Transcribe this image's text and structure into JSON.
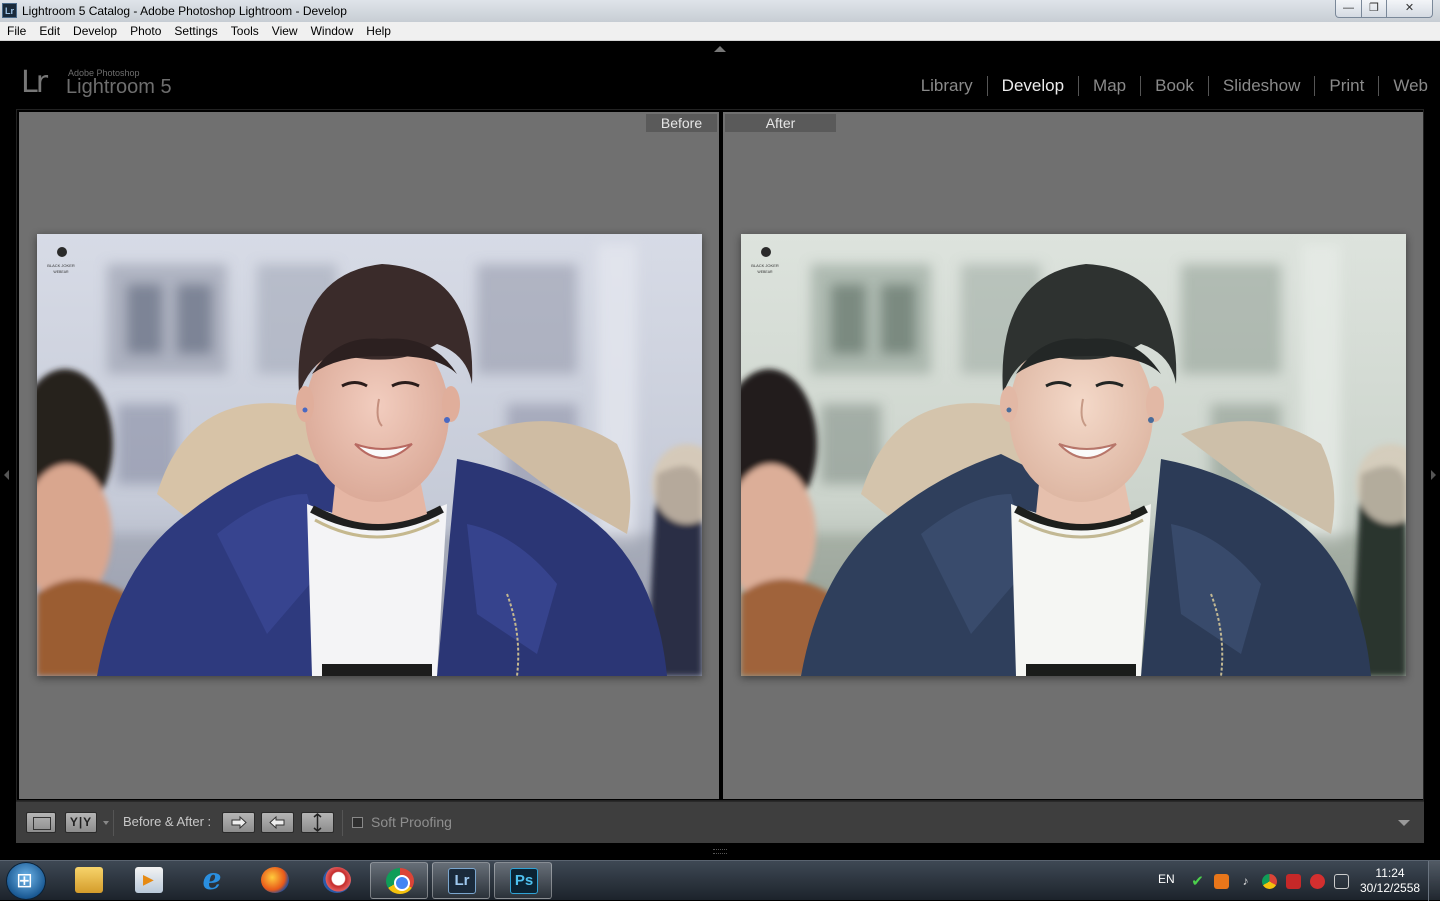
{
  "window": {
    "title": "Lightroom 5 Catalog - Adobe Photoshop Lightroom - Develop",
    "app_badge": "Lr",
    "controls": {
      "minimize": "—",
      "maximize": "❐",
      "close": "✕"
    }
  },
  "menu": [
    "File",
    "Edit",
    "Develop",
    "Photo",
    "Settings",
    "Tools",
    "View",
    "Window",
    "Help"
  ],
  "branding": {
    "logo": "Lr",
    "vendor": "Adobe Photoshop",
    "product": "Lightroom 5"
  },
  "modules": [
    {
      "label": "Library",
      "active": false
    },
    {
      "label": "Develop",
      "active": true
    },
    {
      "label": "Map",
      "active": false
    },
    {
      "label": "Book",
      "active": false
    },
    {
      "label": "Slideshow",
      "active": false
    },
    {
      "label": "Print",
      "active": false
    },
    {
      "label": "Web",
      "active": false
    }
  ],
  "view": {
    "before_label": "Before",
    "after_label": "After",
    "watermark_line1": "BLACK JOKER",
    "watermark_line2": "WEBEAR"
  },
  "toolbar": {
    "view_mode_label": "Y|Y",
    "before_after_label": "Before & After :",
    "soft_proofing_label": "Soft Proofing",
    "soft_proofing_checked": false
  },
  "taskbar": {
    "apps": [
      {
        "name": "windows-explorer",
        "open": false
      },
      {
        "name": "media-player",
        "open": false
      },
      {
        "name": "internet-explorer",
        "open": false
      },
      {
        "name": "firefox",
        "open": false
      },
      {
        "name": "opera",
        "open": false
      },
      {
        "name": "chrome",
        "open": true
      },
      {
        "name": "lightroom",
        "open": true,
        "badge": "Lr"
      },
      {
        "name": "photoshop",
        "open": true,
        "badge": "Ps"
      }
    ],
    "tray": {
      "language": "EN",
      "time": "11:24",
      "date": "30/12/2558"
    }
  },
  "colors": {
    "panel_bg": "#707070",
    "active_module": "#ececec",
    "inactive_module": "#8a8a8a",
    "before_jacket": "#2e3a7e",
    "after_jacket": "#2f3f5c"
  }
}
